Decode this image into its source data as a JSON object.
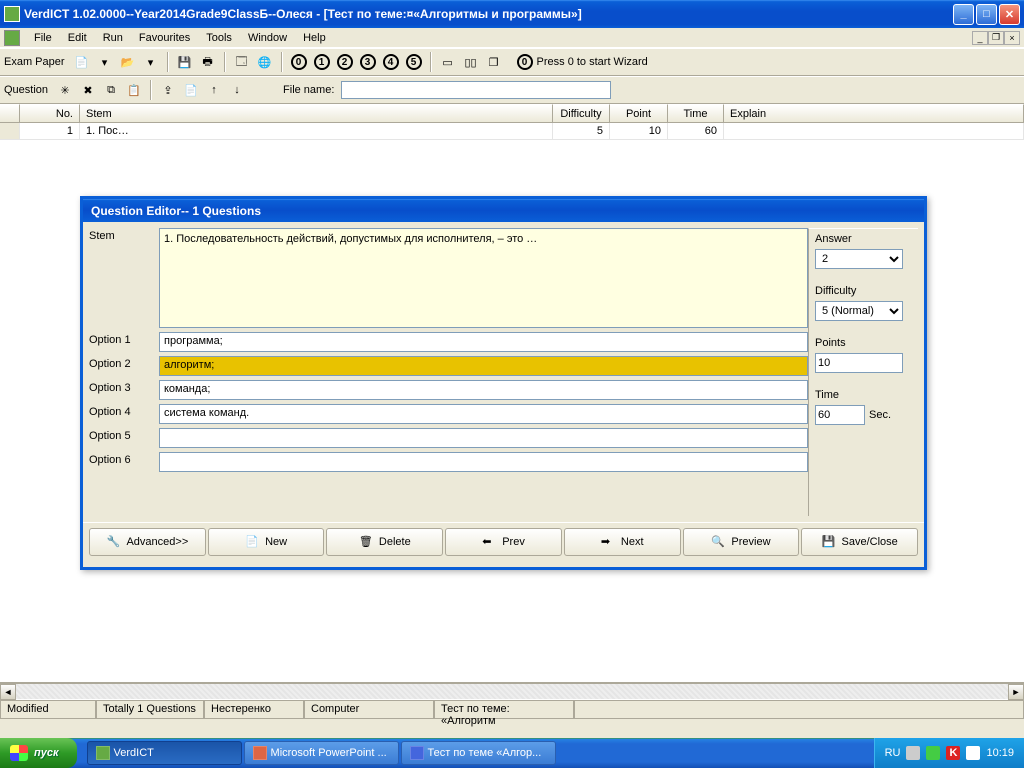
{
  "titlebar": {
    "title": "VerdICT 1.02.0000--Year2014Grade9ClassБ--Олеся - [Тест по теме:¤«Алгоритмы и программы»]"
  },
  "menu": {
    "file": "File",
    "edit": "Edit",
    "run": "Run",
    "favourites": "Favourites",
    "tools": "Tools",
    "window": "Window",
    "help": "Help"
  },
  "toolbar1": {
    "label": "Exam Paper",
    "hint": "Press 0 to start Wizard"
  },
  "toolbar2": {
    "label": "Question",
    "filelabel": "File name:",
    "filename": ""
  },
  "grid": {
    "headers": {
      "no": "No.",
      "stem": "Stem",
      "difficulty": "Difficulty",
      "point": "Point",
      "time": "Time",
      "explain": "Explain"
    },
    "rows": [
      {
        "no": "1",
        "stem": "1. Пос…",
        "difficulty": "5",
        "point": "10",
        "time": "60",
        "explain": ""
      }
    ]
  },
  "dialog": {
    "title": "Question Editor-- 1 Questions",
    "labels": {
      "stem": "Stem",
      "o1": "Option 1",
      "o2": "Option 2",
      "o3": "Option 3",
      "o4": "Option 4",
      "o5": "Option 5",
      "o6": "Option 6",
      "answer": "Answer",
      "difficulty": "Difficulty",
      "points": "Points",
      "time": "Time",
      "sec": "Sec."
    },
    "stem": "1. Последовательность действий, допустимых для исполнителя, – это …",
    "options": {
      "o1": "программа;",
      "o2": "алгоритм;",
      "o3": "команда;",
      "o4": "система команд.",
      "o5": "",
      "o6": ""
    },
    "answer": "2",
    "difficulty": "5 (Normal)",
    "points": "10",
    "time": "60",
    "buttons": {
      "adv": "Advanced>>",
      "new": "New",
      "del": "Delete",
      "prev": "Prev",
      "next": "Next",
      "preview": "Preview",
      "save": "Save/Close"
    }
  },
  "status": {
    "modified": "Modified",
    "total": "Totally 1 Questions",
    "author": "Нестеренко",
    "computer": "Computer",
    "test": "Тест по теме: «Алгоритм"
  },
  "taskbar": {
    "start": "пуск",
    "tasks": [
      {
        "label": "VerdICT"
      },
      {
        "label": "Microsoft PowerPoint ..."
      },
      {
        "label": "Тест по теме «Алгор..."
      }
    ],
    "lang": "RU",
    "clock": "10:19"
  }
}
